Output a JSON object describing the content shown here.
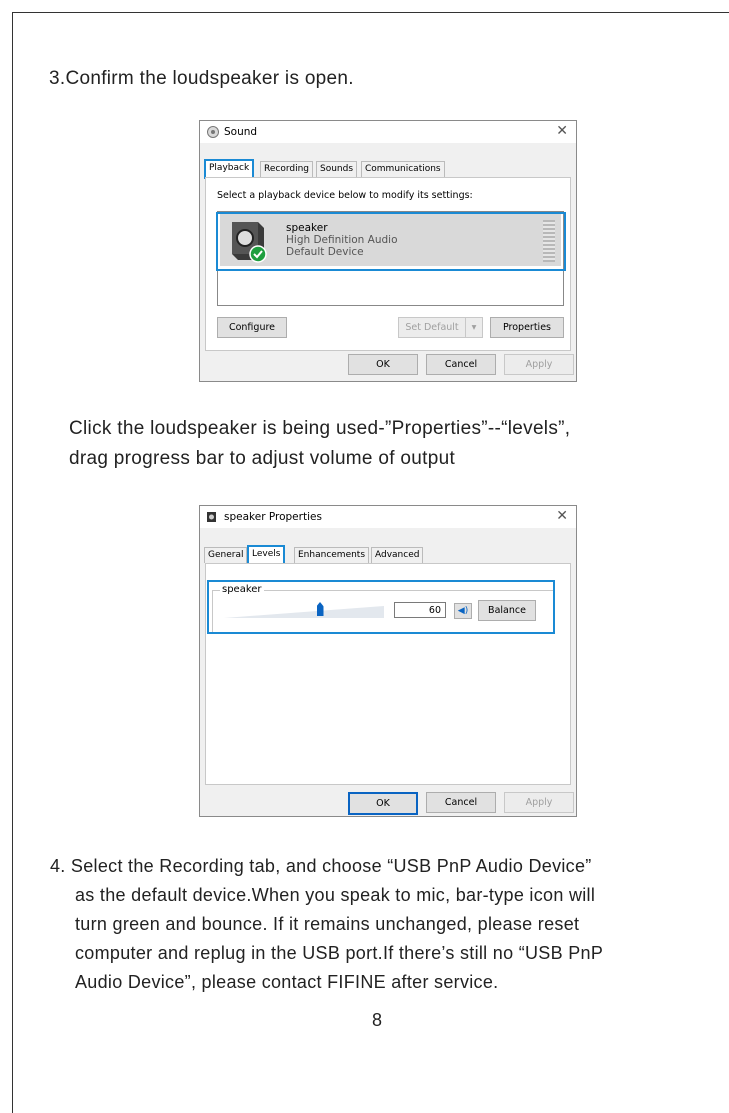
{
  "steps": {
    "step3": "3.Confirm the loudspeaker is open.",
    "click_line1": "Click the loudspeaker is being used-”Properties”--“levels”,",
    "click_line2": "drag progress bar to adjust volume of output",
    "step4_line1": "4. Select the Recording tab, and choose “USB PnP Audio Device”",
    "step4_line2": "as the default device.When you speak to mic, bar-type icon will",
    "step4_line3": "turn green and bounce. If it remains unchanged, please reset",
    "step4_line4": "computer and replug in the USB port.If there’s still no “USB PnP",
    "step4_line5": "Audio Device”, please contact FIFINE after service.",
    "page_number": "8"
  },
  "sound_dialog": {
    "title": "Sound",
    "tabs": [
      "Playback",
      "Recording",
      "Sounds",
      "Communications"
    ],
    "selected_tab": "Playback",
    "instruction": "Select a playback device below to modify its settings:",
    "device": {
      "name": "speaker",
      "driver": "High Definition Audio",
      "status": "Default Device"
    },
    "buttons": {
      "configure": "Configure",
      "set_default": "Set Default",
      "properties": "Properties",
      "ok": "OK",
      "cancel": "Cancel",
      "apply": "Apply"
    }
  },
  "properties_dialog": {
    "title": "speaker Properties",
    "tabs": [
      "General",
      "Levels",
      "Enhancements",
      "Advanced"
    ],
    "selected_tab": "Levels",
    "group_label": "speaker",
    "volume_value": "60",
    "volume_level": 0.6,
    "buttons": {
      "balance": "Balance",
      "ok": "OK",
      "cancel": "Cancel",
      "apply": "Apply"
    }
  },
  "colors": {
    "highlight": "#1a8ad4",
    "check_green": "#1e9e3e",
    "slider_thumb": "#0a64c2"
  }
}
